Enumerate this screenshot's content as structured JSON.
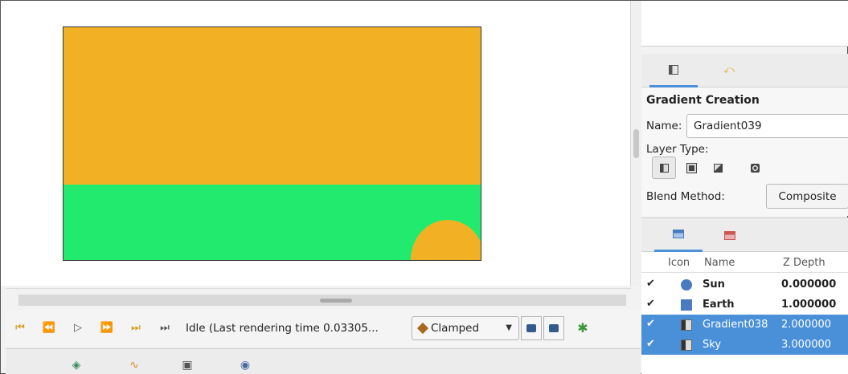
{
  "timebar": {
    "status": "Idle (Last rendering time 0.03305...",
    "interpolation": "Clamped",
    "buttons": [
      "seek-begin",
      "prev-keyframe",
      "play",
      "next-keyframe",
      "seek-end-keyframe",
      "seek-end"
    ]
  },
  "params": {
    "title": "Gradient Creation",
    "name_label": "Name:",
    "name_value": "Gradient039",
    "layer_type_label": "Layer Type:",
    "blend_label": "Blend Method:",
    "blend_value": "Composite"
  },
  "layers": {
    "headers": {
      "icon": "Icon",
      "name": "Name",
      "zdepth": "Z Depth"
    },
    "rows": [
      {
        "checked": true,
        "icon": "circle",
        "name": "Sun",
        "zdepth": "0.000000",
        "selected": false
      },
      {
        "checked": true,
        "icon": "square",
        "name": "Earth",
        "zdepth": "1.000000",
        "selected": false
      },
      {
        "checked": true,
        "icon": "gradient",
        "name": "Gradient038",
        "zdepth": "2.000000",
        "selected": true
      },
      {
        "checked": true,
        "icon": "gradient",
        "name": "Sky",
        "zdepth": "3.000000",
        "selected": true
      }
    ]
  },
  "colors": {
    "sky": "#f2b124",
    "earth": "#22ea6e",
    "sun": "#f2b124",
    "selection": "#4a90d9"
  }
}
